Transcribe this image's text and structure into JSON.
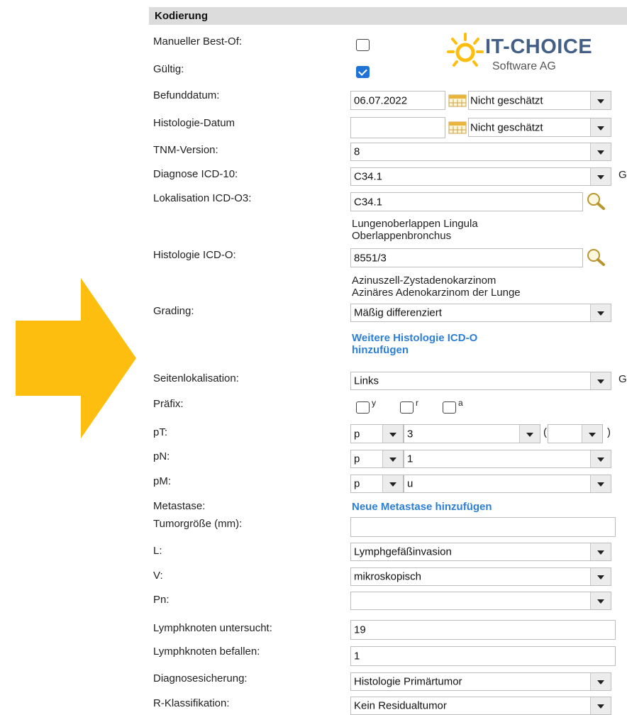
{
  "header": {
    "title": "Kodierung"
  },
  "logo": {
    "name": "IT-CHOICE",
    "subtitle": "Software AG",
    "icon": "sun-icon"
  },
  "colors": {
    "arrow": "#fdbe10",
    "link": "#2c7fd6",
    "checkbox": "#1e74d6",
    "logo_text": "#445f86"
  },
  "labels": {
    "manueller_best_of": "Manueller Best-Of:",
    "gueltig": "Gültig:",
    "befunddatum": "Befunddatum:",
    "histologie_datum": "Histologie-Datum",
    "tnm_version": "TNM-Version:",
    "diagnose": "Diagnose ICD-10:",
    "lokalisation": "Lokalisation ICD-O3:",
    "histologie": "Histologie ICD-O:",
    "grading": "Grading:",
    "seitenlokalisation": "Seitenlokalisation:",
    "praefix": "Präfix:",
    "pt": "pT:",
    "pn": "pN:",
    "pm": "pM:",
    "metastase": "Metastase:",
    "tumorgroesse": "Tumorgröße (mm):",
    "l": "L:",
    "v": "V:",
    "pn2": "Pn:",
    "lk_untersucht": "Lymphknoten untersucht:",
    "lk_befallen": "Lymphknoten befallen:",
    "diagnosesicherung": "Diagnosesicherung:",
    "r_klassifikation": "R-Klassifikation:"
  },
  "values": {
    "manueller_best_of": false,
    "gueltig": true,
    "befunddatum": "06.07.2022",
    "befund_schaetzung": "Nicht geschätzt",
    "histologie_datum": "",
    "histologie_schaetzung": "Nicht geschätzt",
    "tnm_version": "8",
    "diagnose": "C34.1",
    "diagnose_suffix": "G",
    "lokalisation": "C34.1",
    "lokalisation_desc_1": "Lungenoberlappen Lingula",
    "lokalisation_desc_2": "Oberlappenbronchus",
    "histologie": "8551/3",
    "histologie_desc_1": "Azinuszell-Zystadenokarzinom",
    "histologie_desc_2": "Azinäres Adenokarzinom der Lunge",
    "grading": "Mäßig differenziert",
    "weitere_link_1": "Weitere Histologie ICD-O",
    "weitere_link_2": "hinzufügen",
    "seitenlokalisation": "Links",
    "seiten_suffix": "G",
    "praefix_y": "y",
    "praefix_r": "r",
    "praefix_a": "a",
    "pt_prefix": "p",
    "pt_value": "3",
    "pt_paren_open": "(",
    "pt_paren_close": ")",
    "pt_extra": "",
    "pn_prefix": "p",
    "pn_value": "1",
    "pm_prefix": "p",
    "pm_value": "u",
    "metastase_link": "Neue Metastase hinzufügen",
    "tumorgroesse": "",
    "l": "Lymphgefäßinvasion",
    "v": "mikroskopisch",
    "pn2": "",
    "lk_untersucht": "19",
    "lk_befallen": "1",
    "diagnosesicherung": "Histologie Primärtumor",
    "r_klassifikation": "Kein Residualtumor"
  }
}
